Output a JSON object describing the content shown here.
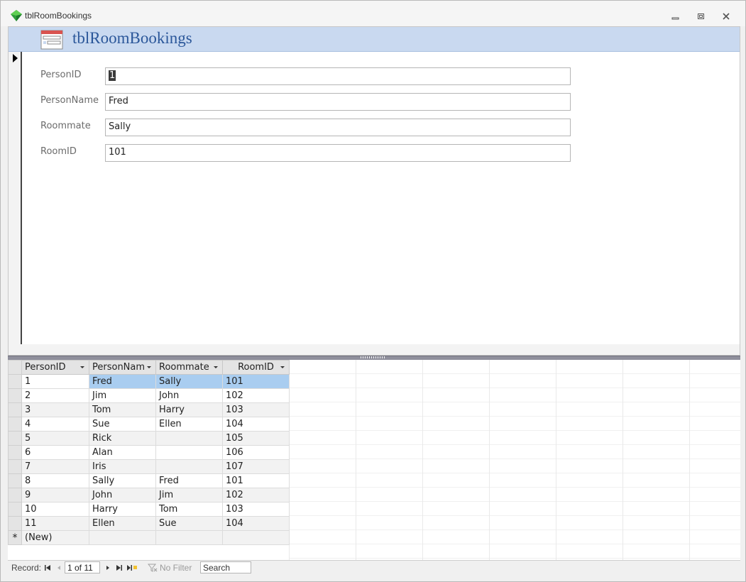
{
  "window": {
    "title": "tblRoomBookings"
  },
  "form": {
    "title": "tblRoomBookings",
    "fields": [
      {
        "label": "PersonID",
        "value": "1"
      },
      {
        "label": "PersonName",
        "value": "Fred"
      },
      {
        "label": "Roommate",
        "value": "Sally"
      },
      {
        "label": "RoomID",
        "value": "101"
      }
    ]
  },
  "datasheet": {
    "columns": [
      "PersonID",
      "PersonNam",
      "Roommate",
      "RoomID"
    ],
    "rows": [
      [
        "1",
        "Fred",
        "Sally",
        "101"
      ],
      [
        "2",
        "Jim",
        "John",
        "102"
      ],
      [
        "3",
        "Tom",
        "Harry",
        "103"
      ],
      [
        "4",
        "Sue",
        "Ellen",
        "104"
      ],
      [
        "5",
        "Rick",
        "",
        "105"
      ],
      [
        "6",
        "Alan",
        "",
        "106"
      ],
      [
        "7",
        "Iris",
        "",
        "107"
      ],
      [
        "8",
        "Sally",
        "Fred",
        "101"
      ],
      [
        "9",
        "John",
        "Jim",
        "102"
      ],
      [
        "10",
        "Harry",
        "Tom",
        "103"
      ],
      [
        "11",
        "Ellen",
        "Sue",
        "104"
      ]
    ],
    "new_row_symbol": "*",
    "new_row_label": "(New)"
  },
  "navbar": {
    "record_label": "Record:",
    "position": "1 of 11",
    "filter_label": "No Filter",
    "search_placeholder": "Search"
  },
  "colors": {
    "header_band": "#c9d9f0",
    "header_title": "#2b579a",
    "current_row_highlight": "#a9cdf0"
  }
}
